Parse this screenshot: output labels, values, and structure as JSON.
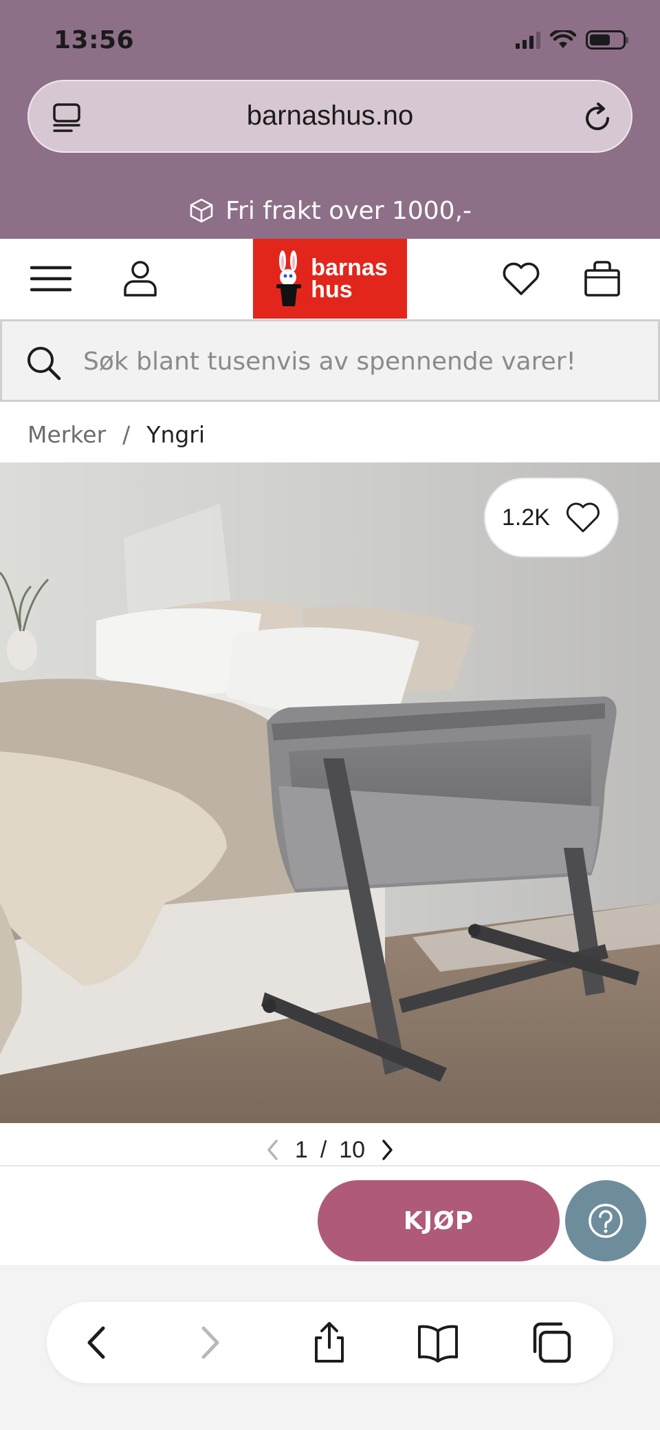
{
  "status_bar": {
    "time": "13:56",
    "icons": [
      "signal-icon",
      "wifi-icon",
      "battery-icon"
    ]
  },
  "browser": {
    "url": "barnashus.no",
    "tabs_icon": "page-menu-icon",
    "reload_icon": "reload-icon"
  },
  "promo": {
    "text": "Fri frakt over 1000,-",
    "icon": "package-icon"
  },
  "header": {
    "menu_icon": "hamburger-menu-icon",
    "account_icon": "user-icon",
    "logo_text_line1": "barnas",
    "logo_text_line2": "hus",
    "wishlist_icon": "heart-icon",
    "cart_icon": "shopping-bag-icon",
    "logo_color": "#e3261b"
  },
  "search": {
    "placeholder": "Søk blant tusenvis av spennende varer!",
    "value": ""
  },
  "breadcrumb": {
    "items": [
      "Merker",
      "Yngri"
    ],
    "separator": "/"
  },
  "product": {
    "likes": "1.2K",
    "image_alt": "Bedside crib",
    "pager_current": "1",
    "pager_separator": "/",
    "pager_total": "10"
  },
  "buy_bar": {
    "buy_label": "KJØP",
    "buy_color": "#b05a79",
    "help_icon": "help-icon",
    "help_color": "#6e8d9c"
  },
  "toolbar": {
    "icons": [
      "back-icon",
      "forward-icon",
      "share-icon",
      "bookmarks-icon",
      "tabs-icon"
    ]
  },
  "colors": {
    "top_bar": "#8d7088",
    "url_bar": "#d7c7d2"
  }
}
